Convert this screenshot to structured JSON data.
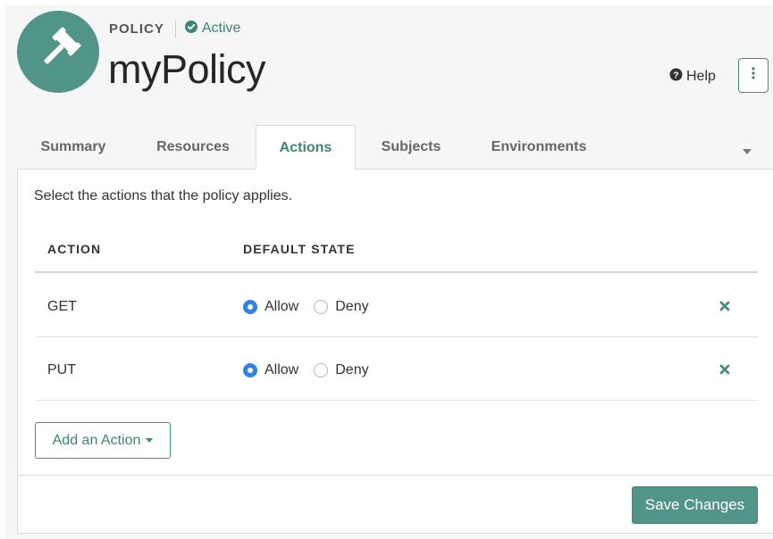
{
  "header": {
    "type_label": "POLICY",
    "status": "Active",
    "title": "myPolicy",
    "avatar_icon": "gavel-icon",
    "help_label": "Help"
  },
  "tabs": [
    {
      "label": "Summary",
      "active": false
    },
    {
      "label": "Resources",
      "active": false
    },
    {
      "label": "Actions",
      "active": true
    },
    {
      "label": "Subjects",
      "active": false
    },
    {
      "label": "Environments",
      "active": false
    }
  ],
  "panel": {
    "intro": "Select the actions that the policy applies.",
    "columns": {
      "action": "ACTION",
      "default_state": "DEFAULT STATE"
    },
    "rows": [
      {
        "action": "GET",
        "allow_label": "Allow",
        "deny_label": "Deny",
        "selected": "Allow"
      },
      {
        "action": "PUT",
        "allow_label": "Allow",
        "deny_label": "Deny",
        "selected": "Allow"
      }
    ],
    "add_action_label": "Add an Action",
    "save_label": "Save Changes"
  },
  "colors": {
    "brand": "#519588",
    "brand_dark": "#3f8277",
    "radio_selected": "#2f82e6"
  }
}
